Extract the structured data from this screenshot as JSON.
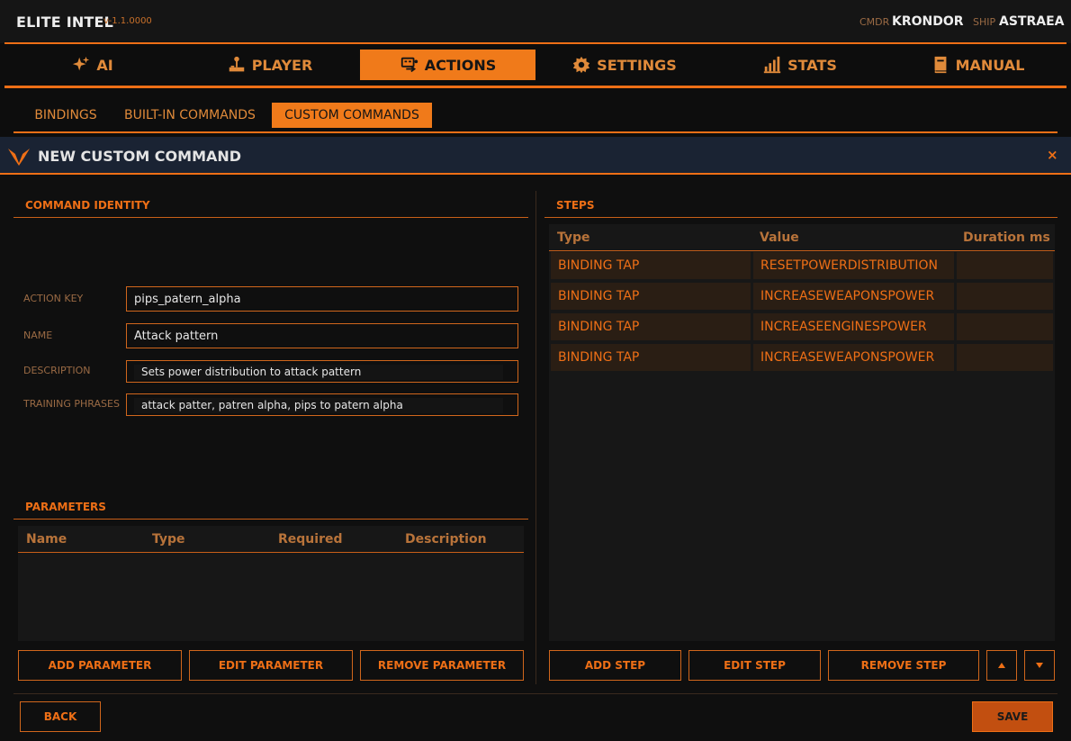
{
  "app": {
    "title": "ELITE INTEL",
    "version": "v-1.1.0000",
    "cmdr_label": "CMDR",
    "cmdr_value": "KRONDOR",
    "ship_label": "SHIP",
    "ship_value": "ASTRAEA"
  },
  "main_tabs": [
    {
      "label": "AI",
      "icon": "sparkle-icon"
    },
    {
      "label": "PLAYER",
      "icon": "joystick-icon"
    },
    {
      "label": "ACTIONS",
      "icon": "actions-icon",
      "active": true
    },
    {
      "label": "SETTINGS",
      "icon": "gear-icon"
    },
    {
      "label": "STATS",
      "icon": "bar-chart-icon"
    },
    {
      "label": "MANUAL",
      "icon": "book-icon"
    }
  ],
  "sub_tabs": [
    {
      "label": "BINDINGS"
    },
    {
      "label": "BUILT-IN COMMANDS"
    },
    {
      "label": "CUSTOM COMMANDS",
      "active": true
    }
  ],
  "dialog": {
    "title": "NEW CUSTOM COMMAND",
    "close": "×"
  },
  "identity": {
    "section_title": "COMMAND IDENTITY",
    "action_key_label": "ACTION KEY",
    "action_key_value": "pips_patern_alpha",
    "name_label": "NAME",
    "name_value": "Attack pattern",
    "description_label": "DESCRIPTION",
    "description_value": "Sets power distribution to attack pattern",
    "training_label": "TRAINING PHRASES",
    "training_value": "attack patter, patren alpha, pips to patern alpha"
  },
  "parameters": {
    "section_title": "PARAMETERS",
    "columns": [
      "Name",
      "Type",
      "Required",
      "Description"
    ],
    "buttons": {
      "add": "ADD PARAMETER",
      "edit": "EDIT PARAMETER",
      "remove": "REMOVE PARAMETER"
    }
  },
  "steps": {
    "section_title": "STEPS",
    "columns": [
      "Type",
      "Value",
      "Duration ms"
    ],
    "rows": [
      {
        "type": "BINDING TAP",
        "value": "RESETPOWERDISTRIBUTION",
        "duration": ""
      },
      {
        "type": "BINDING TAP",
        "value": "INCREASEWEAPONSPOWER",
        "duration": ""
      },
      {
        "type": "BINDING TAP",
        "value": "INCREASEENGINESPOWER",
        "duration": ""
      },
      {
        "type": "BINDING TAP",
        "value": "INCREASEWEAPONSPOWER",
        "duration": ""
      }
    ],
    "buttons": {
      "add": "ADD STEP",
      "edit": "EDIT STEP",
      "remove": "REMOVE STEP"
    }
  },
  "footer": {
    "back": "BACK",
    "save": "SAVE"
  },
  "colors": {
    "accent": "#ee6f16",
    "active_tab": "#f07a1a",
    "header_bg": "#1a2333",
    "row_bg": "#2a1e14"
  }
}
